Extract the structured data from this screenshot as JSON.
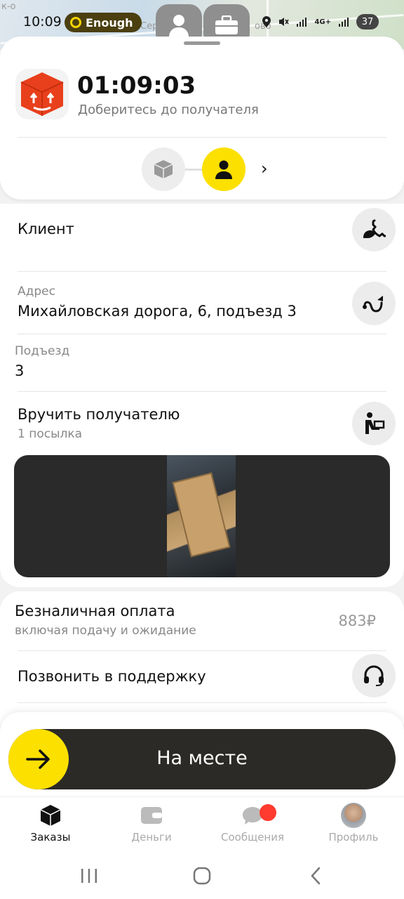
{
  "status_bar": {
    "time": "10:09",
    "enough_label": "Enough",
    "network": "4G+",
    "battery": "37"
  },
  "map": {
    "labels": [
      "к-о",
      "Сер",
      "ово"
    ]
  },
  "order": {
    "timer": "01:09:03",
    "subtitle": "Доберитесь до получателя"
  },
  "details": {
    "client_title": "Клиент",
    "address_label": "Адрес",
    "address_value": "Михайловская дорога, 6, подъезд 3",
    "entrance_label": "Подъезд",
    "entrance_value": "3",
    "handover_title": "Вручить получателю",
    "handover_sub": "1 посылка"
  },
  "payment": {
    "title": "Безналичная оплата",
    "subtitle": "включая подачу и ожидание",
    "amount": "883₽"
  },
  "support": {
    "title": "Позвонить в поддержку"
  },
  "action": {
    "label": "На месте"
  },
  "tabs": [
    {
      "label": "Заказы",
      "icon": "orders-icon",
      "active": true
    },
    {
      "label": "Деньги",
      "icon": "wallet-icon",
      "active": false
    },
    {
      "label": "Сообщения",
      "icon": "chat-icon",
      "active": false
    },
    {
      "label": "Профиль",
      "icon": "avatar",
      "active": false
    }
  ],
  "colors": {
    "accent": "#fce000",
    "dark": "#2b2a27",
    "badge": "#ff3b2f",
    "parcel": "#e8401c"
  }
}
